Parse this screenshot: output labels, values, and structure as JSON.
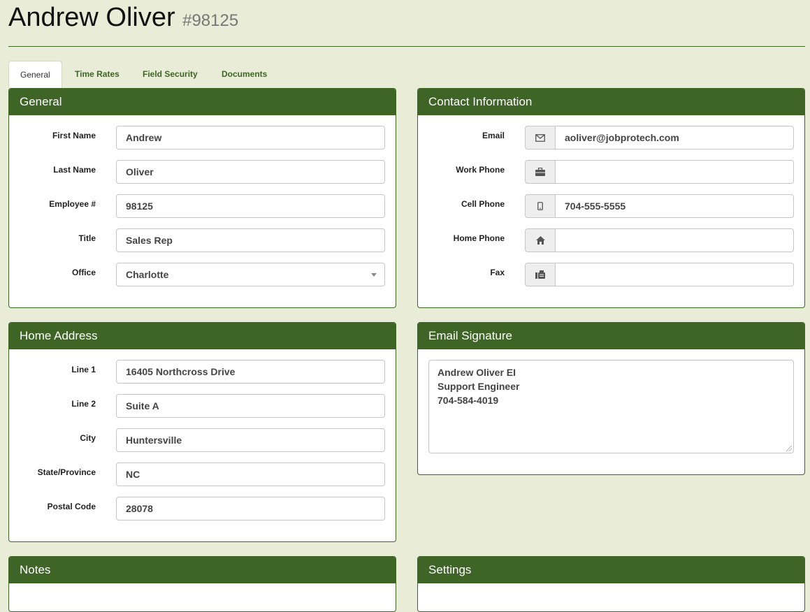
{
  "header": {
    "name": "Andrew Oliver",
    "id": "#98125"
  },
  "tabs": [
    {
      "label": "General",
      "active": true
    },
    {
      "label": "Time Rates",
      "active": false
    },
    {
      "label": "Field Security",
      "active": false
    },
    {
      "label": "Documents",
      "active": false
    }
  ],
  "general": {
    "title": "General",
    "first_name": {
      "label": "First Name",
      "value": "Andrew"
    },
    "last_name": {
      "label": "Last Name",
      "value": "Oliver"
    },
    "employee_no": {
      "label": "Employee #",
      "value": "98125"
    },
    "job_title": {
      "label": "Title",
      "value": "Sales Rep"
    },
    "office": {
      "label": "Office",
      "value": "Charlotte"
    }
  },
  "contact": {
    "title": "Contact Information",
    "email": {
      "label": "Email",
      "value": "aoliver@jobprotech.com",
      "icon": "envelope-icon"
    },
    "work_phone": {
      "label": "Work Phone",
      "value": "",
      "icon": "briefcase-icon"
    },
    "cell_phone": {
      "label": "Cell Phone",
      "value": "704-555-5555",
      "icon": "mobile-phone-icon"
    },
    "home_phone": {
      "label": "Home Phone",
      "value": "",
      "icon": "home-icon"
    },
    "fax": {
      "label": "Fax",
      "value": "",
      "icon": "fax-icon"
    }
  },
  "home_address": {
    "title": "Home Address",
    "line1": {
      "label": "Line 1",
      "value": "16405 Northcross Drive"
    },
    "line2": {
      "label": "Line 2",
      "value": "Suite A"
    },
    "city": {
      "label": "City",
      "value": "Huntersville"
    },
    "state": {
      "label": "State/Province",
      "value": "NC"
    },
    "postal": {
      "label": "Postal Code",
      "value": "28078"
    }
  },
  "email_signature": {
    "title": "Email Signature",
    "lines": [
      "Andrew Oliver EI",
      "Support Engineer",
      "704-584-4019"
    ]
  },
  "notes": {
    "title": "Notes"
  },
  "settings": {
    "title": "Settings"
  },
  "colors": {
    "accent": "#3e6526",
    "background": "#e9ecd7"
  }
}
